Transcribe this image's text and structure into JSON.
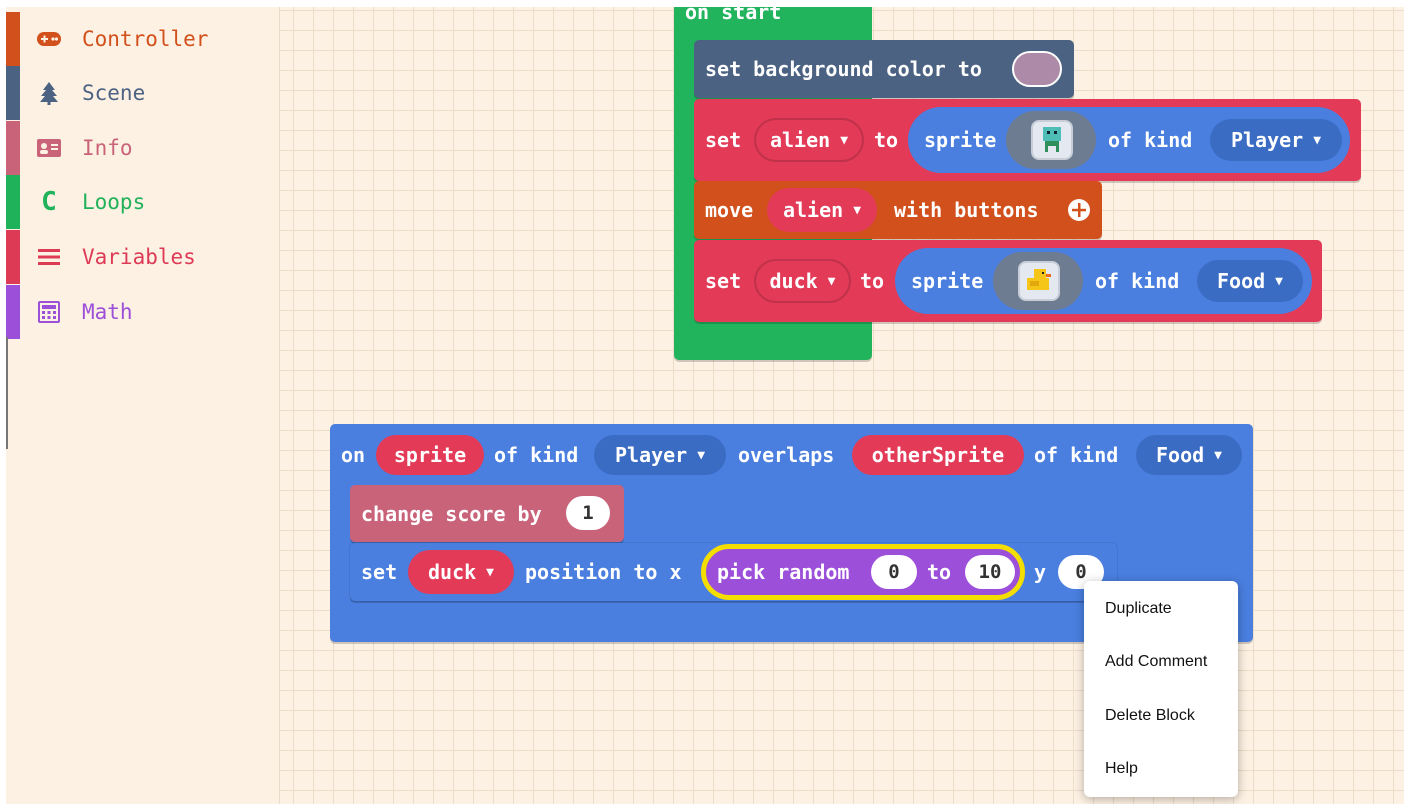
{
  "toolbox": {
    "categories": [
      {
        "label": "Controller",
        "color": "#d2501b",
        "icon": "gamepad-icon"
      },
      {
        "label": "Scene",
        "color": "#4b6283",
        "icon": "tree-icon"
      },
      {
        "label": "Info",
        "color": "#c8637a",
        "icon": "id-card-icon"
      },
      {
        "label": "Loops",
        "color": "#20b25a",
        "icon": "loop-arrow-icon"
      },
      {
        "label": "Variables",
        "color": "#dd3a55",
        "icon": "list-lines-icon"
      },
      {
        "label": "Math",
        "color": "#9c4fd9",
        "icon": "calculator-icon"
      }
    ]
  },
  "on_start": {
    "hat_label": "on start",
    "hat_color": "#21b45d",
    "set_bg": {
      "text": "set background color to",
      "color": "#4b6283",
      "swatch": "#ad8ba8"
    },
    "set_alien": {
      "set": "set",
      "var": "alien",
      "to": "to",
      "sprite": "sprite",
      "of_kind": "of kind",
      "kind": "Player",
      "color": "#e23a57",
      "pill_color": "#4a7fe0",
      "sprite_icon": "alien-sprite-icon"
    },
    "move": {
      "move": "move",
      "var": "alien",
      "with_buttons": "with buttons",
      "color": "#d2501b"
    },
    "set_duck": {
      "set": "set",
      "var": "duck",
      "to": "to",
      "sprite": "sprite",
      "of_kind": "of kind",
      "kind": "Food",
      "color": "#e23a57",
      "sprite_icon": "duck-sprite-icon"
    }
  },
  "overlap_event": {
    "on": "on",
    "sprite_var": "sprite",
    "of_kind_1": "of kind",
    "kind_1": "Player",
    "overlaps": "overlaps",
    "other_var": "otherSprite",
    "of_kind_2": "of kind",
    "kind_2": "Food",
    "color": "#4a7fe0",
    "change_score": {
      "text": "change score by",
      "value": "1",
      "color": "#c8637a"
    },
    "set_position": {
      "set": "set",
      "var": "duck",
      "position_to_x": "position to x",
      "pick_random": "pick random",
      "from": "0",
      "to": "to",
      "max": "10",
      "y": "y",
      "y_value": "0",
      "color": "#4a7fe0",
      "random_color": "#9c4fd9",
      "highlight_color": "#f3de00"
    }
  },
  "context_menu": {
    "items": [
      "Duplicate",
      "Add Comment",
      "Delete Block",
      "Help"
    ]
  }
}
